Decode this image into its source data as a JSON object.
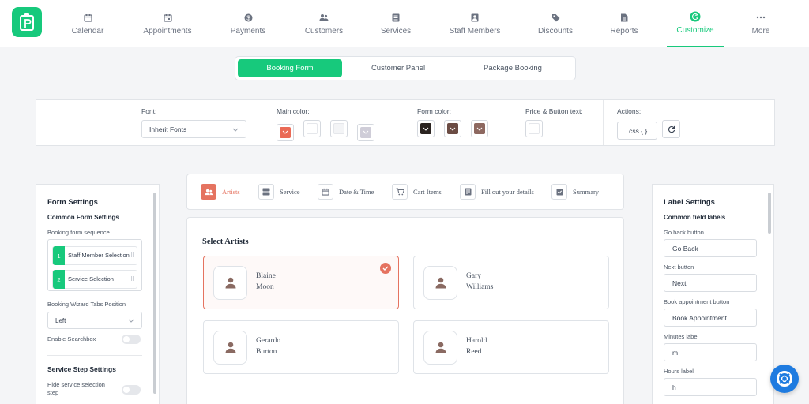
{
  "nav": {
    "items": [
      {
        "label": "Calendar",
        "icon": "calendar-icon"
      },
      {
        "label": "Appointments",
        "icon": "appointments-icon"
      },
      {
        "label": "Payments",
        "icon": "dollar-icon"
      },
      {
        "label": "Customers",
        "icon": "users-icon"
      },
      {
        "label": "Services",
        "icon": "services-icon"
      },
      {
        "label": "Staff Members",
        "icon": "staff-icon"
      },
      {
        "label": "Discounts",
        "icon": "tag-icon"
      },
      {
        "label": "Reports",
        "icon": "report-icon"
      },
      {
        "label": "Customize",
        "icon": "palette-icon"
      },
      {
        "label": "More",
        "icon": "more-icon"
      }
    ],
    "active": "Customize"
  },
  "tabs": [
    "Booking Form",
    "Customer Panel",
    "Package Booking"
  ],
  "toolbar": {
    "font_label": "Font:",
    "font_value": "Inherit Fonts",
    "main_color_label": "Main color:",
    "form_color_label": "Form color:",
    "price_button_label": "Price & Button text:",
    "actions_label": "Actions:",
    "css_button": ".css { }",
    "main_colors": [
      "#ea6a56",
      "#ffffff",
      "#f3f4f6",
      "#cfcdd8"
    ],
    "form_colors": [
      "#2a2320",
      "#6b4c44",
      "#8d6860"
    ],
    "price_color": "#ffffff"
  },
  "left_panel": {
    "title": "Form Settings",
    "common_title": "Common Form Settings",
    "sequence_label": "Booking form sequence",
    "sequence": [
      {
        "num": "1",
        "label": "Staff Member Selection"
      },
      {
        "num": "2",
        "label": "Service Selection"
      }
    ],
    "wizard_label": "Booking Wizard Tabs Position",
    "wizard_value": "Left",
    "searchbox_label": "Enable Searchbox",
    "service_title": "Service Step Settings",
    "hide_service_label": "Hide service selection step"
  },
  "steps": [
    {
      "label": "Artists",
      "icon": "users-icon"
    },
    {
      "label": "Service",
      "icon": "list-icon"
    },
    {
      "label": "Date & Time",
      "icon": "calendar-icon"
    },
    {
      "label": "Cart Items",
      "icon": "cart-icon"
    },
    {
      "label": "Fill out your details",
      "icon": "form-icon"
    },
    {
      "label": "Summary",
      "icon": "summary-icon"
    }
  ],
  "content": {
    "title": "Select Artists",
    "artists": [
      {
        "first": "Blaine",
        "last": "Moon",
        "selected": true
      },
      {
        "first": "Gary",
        "last": "Williams",
        "selected": false
      },
      {
        "first": "Gerardo",
        "last": "Burton",
        "selected": false
      },
      {
        "first": "Harold",
        "last": "Reed",
        "selected": false
      }
    ]
  },
  "right_panel": {
    "title": "Label Settings",
    "common_title": "Common field labels",
    "fields": [
      {
        "label": "Go back button",
        "value": "Go Back"
      },
      {
        "label": "Next button",
        "value": "Next"
      },
      {
        "label": "Book appointment button",
        "value": "Book Appointment"
      },
      {
        "label": "Minutes label",
        "value": "m"
      },
      {
        "label": "Hours label",
        "value": "h"
      }
    ]
  },
  "colors": {
    "accent": "#17c97c",
    "selected": "#e57360",
    "fab": "#1e7be0"
  }
}
